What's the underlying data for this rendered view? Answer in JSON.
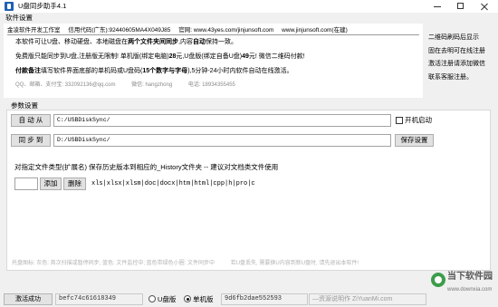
{
  "window": {
    "title": "U盘同步助手4.1",
    "icons": {
      "app": "usb-sync-app-icon",
      "minimize": "minimize-icon",
      "maximize": "maximize-icon",
      "close": "close-icon"
    }
  },
  "colors": {
    "accent": "#1e5fb4",
    "window_bg": "#f0f0f0",
    "panel_bg": "#ffffff",
    "hint_text": "#b3b3b3",
    "watermark_green": "#3c9d4b"
  },
  "menu": {
    "settings": "软件设置"
  },
  "info": {
    "header": {
      "company": "金凌软件开发工作室",
      "credit_code": "信用代码(广东):92440605MA4X049J85",
      "website": "官网: www.43yes.com/jinjunsoft.com",
      "website_new": "www.jinjunsoft.com(在建)"
    },
    "intro": [
      "本软件可让U盘、移动硬盘、本地磁盘在",
      "两个文件夹间同步",
      ",内容",
      "自动",
      "保持一致。"
    ],
    "pricing": [
      "免费版只能同步到U盘,注册版无限制! 单机版(绑定电脑)",
      "28",
      "元,U盘版(绑定自备U盘)",
      "49",
      "元! 微信二维码付款!"
    ],
    "payment_note": [
      "付款备注",
      "填写软件界面底部的单机码或U盘码(",
      "15个数字与字母",
      "),5分钟-24小时内软件自动在线激活。"
    ],
    "contact": {
      "qq": "QQ、邮箱、支付宝: 332092136@qq.com",
      "wechat": "微信: hangzhong",
      "phone": "电话: 18934355455"
    }
  },
  "side_links": [
    "二维码刷码后显示",
    "固在去明可在线注册",
    "激活注册请添加微信",
    "联系客服注册。"
  ],
  "params": {
    "group_title": "参数设置",
    "source_button": "自 动 从",
    "source_path": "C:/USBDiskSync/",
    "autostart_label": "开机启动",
    "autostart_checked": false,
    "target_button": "同 步 到",
    "target_path": "D:/USBDiskSync/",
    "save_button": "保存设置",
    "history_description": "对指定文件类型(扩展名) 保存历史版本到相应的_History文件夹 -- 建议对文档类文件使用",
    "extension_input": "",
    "add_button": "添加",
    "delete_button": "删除",
    "extensions": "xls|xlsx|xlsm|doc|docx|htm|html|cpp|h|pro|c"
  },
  "tray_hint": [
    "托盘图标: 灰色: 首次扫描或暂停同步, 蓝色: 文件监控中; 蓝色带绿色小圈: 文件同步中",
    "若U盘丢失, 需要换U内容到新U盘时, 请先退出本软件!"
  ],
  "status": {
    "activation": "激活成功",
    "machine_code": "befc74c61618349",
    "editions": [
      "U盘版",
      "单机版"
    ],
    "selected_edition_index": 1,
    "usb_code": "9d6fb2dae552593",
    "note": "—资源说明作 ZiYuanMi.com"
  },
  "watermark": {
    "name": "当下软件园",
    "url": "www.downxia.com",
    "icon": "downxia-logo-icon"
  }
}
